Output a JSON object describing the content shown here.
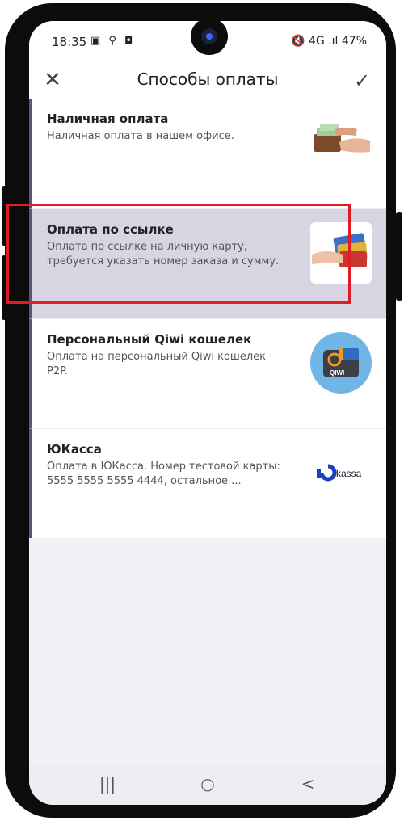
{
  "status": {
    "time": "18:35",
    "left_icons": "▣ ⚲ ◘",
    "right": "🔇 4G .ıl 47%"
  },
  "appbar": {
    "title": "Способы оплаты",
    "close_icon": "close-icon",
    "confirm_icon": "check-icon"
  },
  "methods": [
    {
      "name": "Наличная оплата",
      "desc": "Наличная оплата в нашем офисе.",
      "icon": "cash-in-hand-image"
    },
    {
      "name": "Оплата по ссылке",
      "desc": "Оплата по ссылке на личную карту, требуется указать номер заказа и сумму.",
      "icon": "cards-in-hand-image",
      "selected": true
    },
    {
      "name": "Персональный Qiwi кошелек",
      "desc": "Оплата на персональный Qiwi кошелек P2P.",
      "icon": "qiwi-wallet-image"
    },
    {
      "name": "ЮКасса",
      "desc": "Оплата в ЮКасса. Номер тестовой карты: 5555 5555 5555 4444, остальное ...",
      "icon": "yookassa-logo"
    }
  ],
  "yookassa_logo_text": "kassa",
  "qiwi_logo_text": "QIWI",
  "navbar": {
    "recents": "|||",
    "home": "○",
    "back": "<"
  },
  "colors": {
    "selected_bg": "#d7d5e1",
    "highlight_border": "#e01c24",
    "accent_left": "#5c527f"
  }
}
